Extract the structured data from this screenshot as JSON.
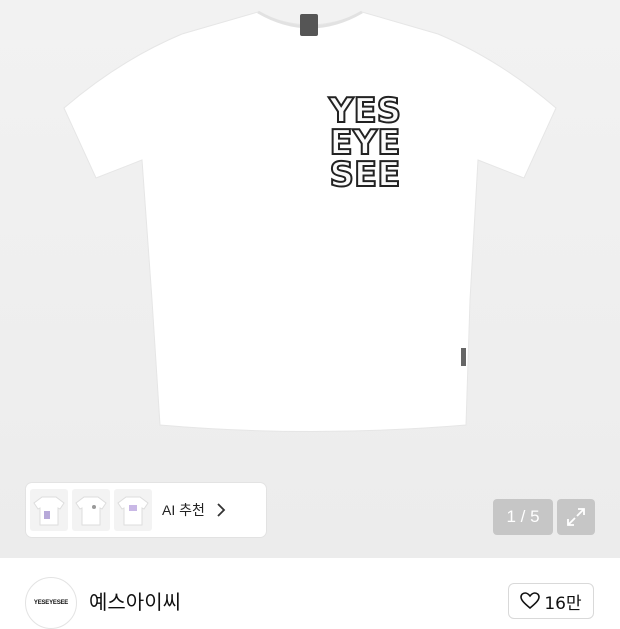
{
  "product": {
    "image_counter": "1 / 5",
    "ai_recommend_label": "AI 추천",
    "print_text": [
      "YES",
      "EYE",
      "SEE"
    ]
  },
  "brand": {
    "logo_text": "YESEYESEE",
    "name": "예스아이씨",
    "likes": "16만"
  },
  "colors": {
    "gallery_bg": "#efefef",
    "counter_bg": "#c6c6c6"
  },
  "icons": {
    "expand": "expand-icon",
    "chevron": "chevron-right-icon",
    "heart": "heart-icon"
  }
}
